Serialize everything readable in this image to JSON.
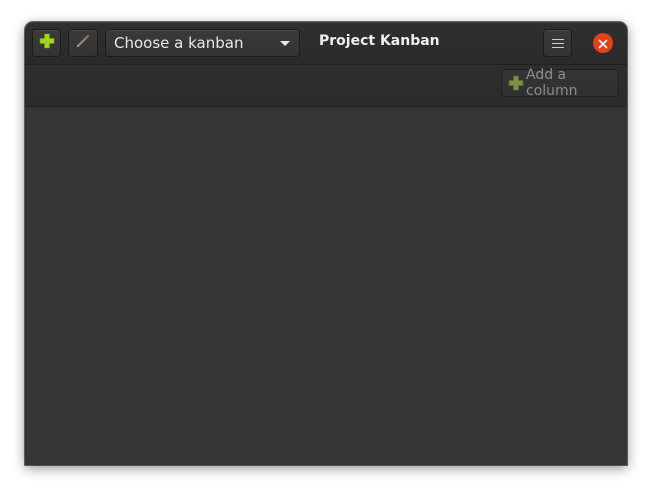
{
  "window": {
    "title": "Project Kanban"
  },
  "headerbar": {
    "add_kanban_icon": "plus-icon",
    "edit_kanban_icon": "pencil-icon",
    "kanban_selector": {
      "placeholder": "Choose a kanban",
      "icon": "chevron-down-icon"
    },
    "menu_icon": "hamburger-menu-icon",
    "close_icon": "close-icon"
  },
  "toolbar": {
    "add_column_label": "Add a column",
    "add_column_icon": "plus-icon"
  },
  "colors": {
    "accent_plus": "#9fd61e",
    "plus_disabled": "#7d9046",
    "close": "#e2421a",
    "background": "#353535"
  }
}
